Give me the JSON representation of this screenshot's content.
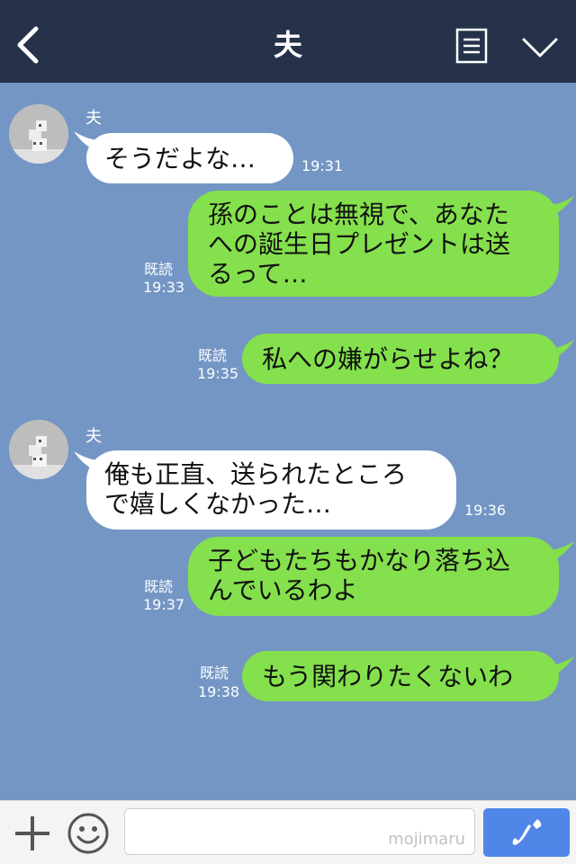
{
  "header": {
    "title": "夫"
  },
  "messages": [
    {
      "direction": "in",
      "sender": "夫",
      "text": "そうだよな…",
      "time": "19:31"
    },
    {
      "direction": "out",
      "lines": [
        "孫のことは無視で、あなた",
        "への誕生日プレゼントは送",
        "るって…"
      ],
      "read": "既読",
      "time": "19:33"
    },
    {
      "direction": "out",
      "text": "私への嫌がらせよね？",
      "read": "既読",
      "time": "19:35"
    },
    {
      "direction": "in",
      "sender": "夫",
      "lines": [
        "俺も正直、送られたところ",
        "で嬉しくなかった…"
      ],
      "time": "19:36"
    },
    {
      "direction": "out",
      "lines": [
        "子どもたちもかなり落ち込",
        "んでいるわよ"
      ],
      "read": "既読",
      "time": "19:37"
    },
    {
      "direction": "out",
      "text": "もう関わりたくないわ",
      "read": "既読",
      "time": "19:38"
    }
  ],
  "footer": {
    "input_value": "",
    "watermark": "mojimaru"
  },
  "colors": {
    "header": "#25324a",
    "background": "#7496c4",
    "outgoing_bubble": "#84e04c",
    "incoming_bubble": "#ffffff",
    "call_button": "#4f86e8"
  },
  "icons": [
    "back-chevron-icon",
    "menu-icon",
    "chevron-down-icon",
    "plus-icon",
    "emoji-icon",
    "phone-icon"
  ]
}
